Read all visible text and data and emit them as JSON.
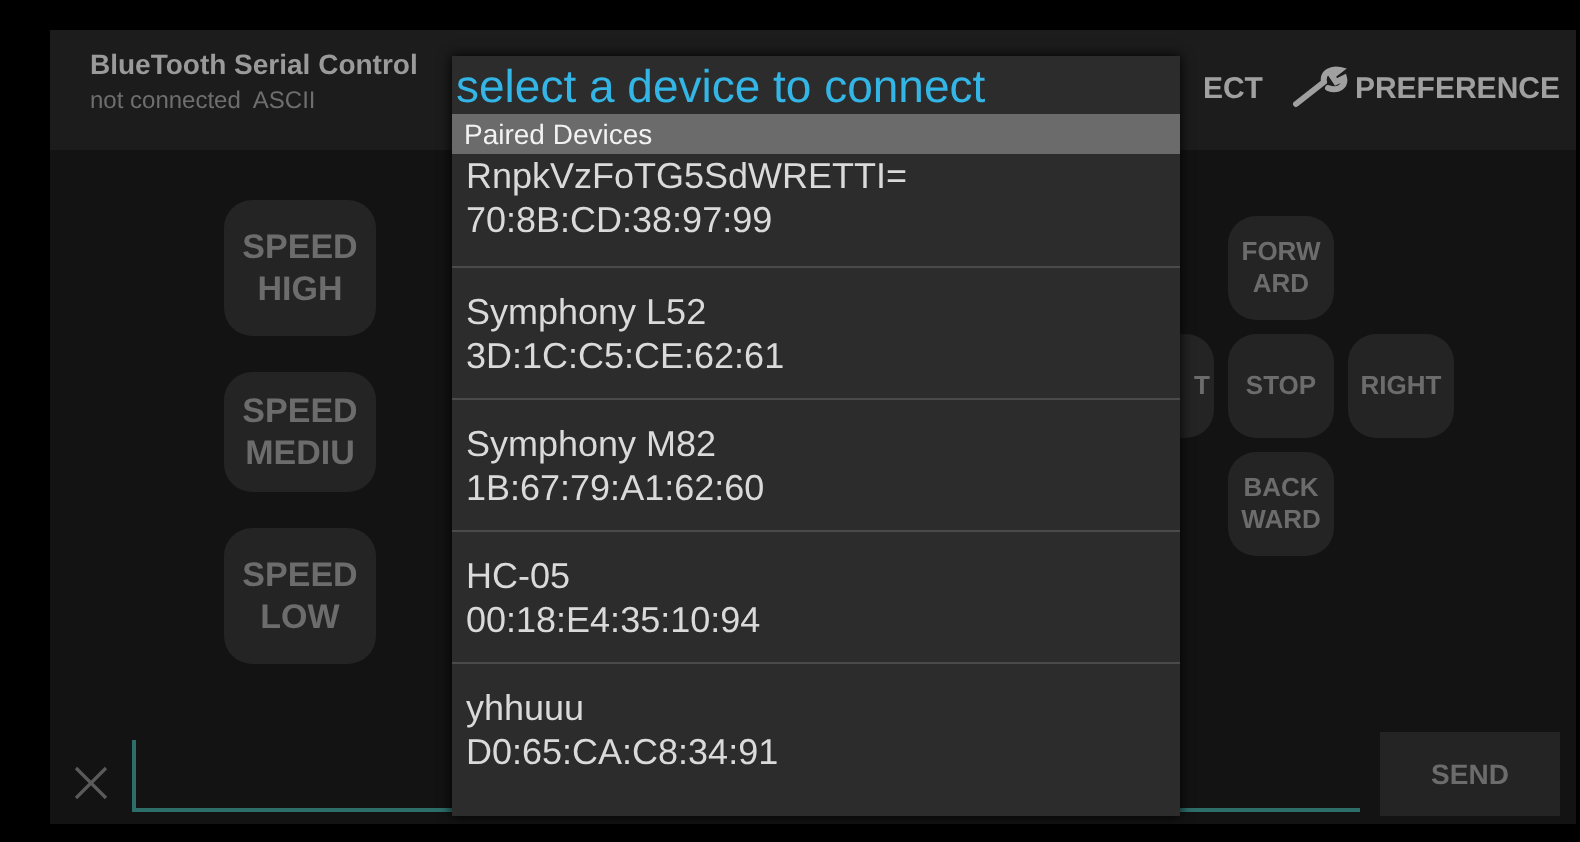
{
  "header": {
    "title": "BlueTooth Serial Control",
    "status": "not connected  ASCII",
    "actions": [
      {
        "label": "ECT",
        "kind": "text"
      },
      {
        "label": "PREFERENCE",
        "kind": "wrench"
      }
    ]
  },
  "speed_buttons": [
    {
      "lines": [
        "SPEED",
        "HIGH"
      ]
    },
    {
      "lines": [
        "SPEED",
        "MEDIU"
      ]
    },
    {
      "lines": [
        "SPEED",
        "LOW"
      ]
    }
  ],
  "direction_buttons": [
    {
      "lines": [
        "FORW",
        "ARD"
      ],
      "kind": "up"
    },
    {
      "lines": [
        "T"
      ],
      "kind": "left"
    },
    {
      "lines": [
        "STOP"
      ],
      "kind": "center"
    },
    {
      "lines": [
        "RIGHT"
      ],
      "kind": "right"
    },
    {
      "lines": [
        "BACK",
        "WARD"
      ],
      "kind": "down"
    }
  ],
  "dialog": {
    "title": "select a device to connect",
    "section": "Paired Devices",
    "devices": [
      {
        "name": "RnpkVzFoTG5SdWRETTI=",
        "address": "70:8B:CD:38:97:99"
      },
      {
        "name": "Symphony L52",
        "address": "3D:1C:C5:CE:62:61"
      },
      {
        "name": "Symphony M82",
        "address": "1B:67:79:A1:62:60"
      },
      {
        "name": "HC-05",
        "address": "00:18:E4:35:10:94"
      },
      {
        "name": "yhhuuu",
        "address": "D0:65:CA:C8:34:91"
      }
    ]
  },
  "send_button": "SEND"
}
